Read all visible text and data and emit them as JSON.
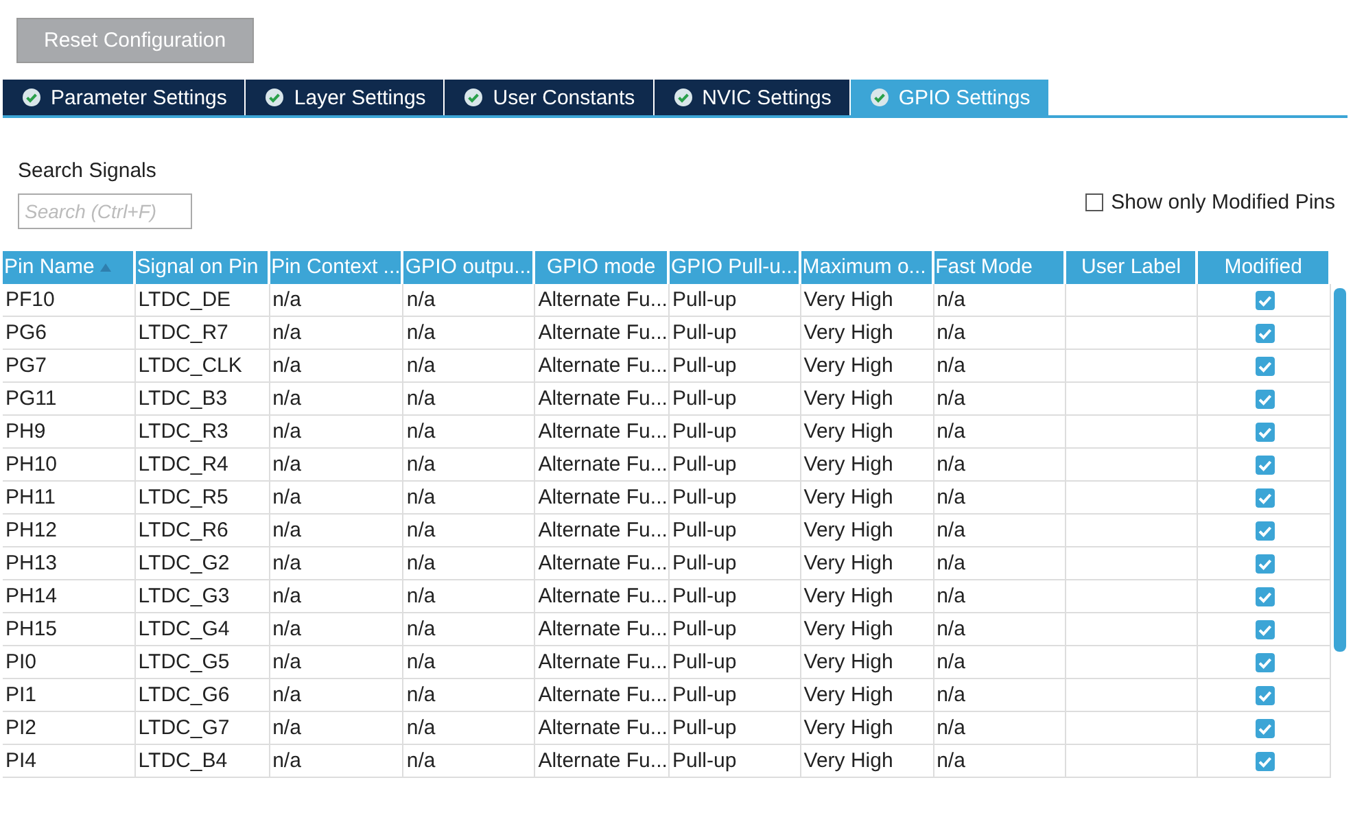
{
  "reset_button": "Reset Configuration",
  "tabs": [
    {
      "label": "Parameter Settings",
      "selected": false
    },
    {
      "label": "Layer Settings",
      "selected": false
    },
    {
      "label": "User Constants",
      "selected": false
    },
    {
      "label": "NVIC Settings",
      "selected": false
    },
    {
      "label": "GPIO Settings",
      "selected": true
    }
  ],
  "search": {
    "label": "Search Signals",
    "placeholder": "Search (Ctrl+F)"
  },
  "show_only_modified": {
    "label": "Show only Modified Pins",
    "checked": false
  },
  "table": {
    "columns": [
      "Pin Name",
      "Signal on Pin",
      "Pin Context ...",
      "GPIO outpu...",
      "GPIO mode",
      "GPIO Pull-u...",
      "Maximum o...",
      "Fast Mode",
      "User Label",
      "Modified"
    ],
    "rows": [
      {
        "cells": [
          "PF10",
          "LTDC_DE",
          "n/a",
          "n/a",
          "Alternate Fu...",
          "Pull-up",
          "Very High",
          "n/a"
        ],
        "modified": true
      },
      {
        "cells": [
          "PG6",
          "LTDC_R7",
          "n/a",
          "n/a",
          "Alternate Fu...",
          "Pull-up",
          "Very High",
          "n/a"
        ],
        "modified": true
      },
      {
        "cells": [
          "PG7",
          "LTDC_CLK",
          "n/a",
          "n/a",
          "Alternate Fu...",
          "Pull-up",
          "Very High",
          "n/a"
        ],
        "modified": true
      },
      {
        "cells": [
          "PG11",
          "LTDC_B3",
          "n/a",
          "n/a",
          "Alternate Fu...",
          "Pull-up",
          "Very High",
          "n/a"
        ],
        "modified": true
      },
      {
        "cells": [
          "PH9",
          "LTDC_R3",
          "n/a",
          "n/a",
          "Alternate Fu...",
          "Pull-up",
          "Very High",
          "n/a"
        ],
        "modified": true
      },
      {
        "cells": [
          "PH10",
          "LTDC_R4",
          "n/a",
          "n/a",
          "Alternate Fu...",
          "Pull-up",
          "Very High",
          "n/a"
        ],
        "modified": true
      },
      {
        "cells": [
          "PH11",
          "LTDC_R5",
          "n/a",
          "n/a",
          "Alternate Fu...",
          "Pull-up",
          "Very High",
          "n/a"
        ],
        "modified": true
      },
      {
        "cells": [
          "PH12",
          "LTDC_R6",
          "n/a",
          "n/a",
          "Alternate Fu...",
          "Pull-up",
          "Very High",
          "n/a"
        ],
        "modified": true
      },
      {
        "cells": [
          "PH13",
          "LTDC_G2",
          "n/a",
          "n/a",
          "Alternate Fu...",
          "Pull-up",
          "Very High",
          "n/a"
        ],
        "modified": true
      },
      {
        "cells": [
          "PH14",
          "LTDC_G3",
          "n/a",
          "n/a",
          "Alternate Fu...",
          "Pull-up",
          "Very High",
          "n/a"
        ],
        "modified": true
      },
      {
        "cells": [
          "PH15",
          "LTDC_G4",
          "n/a",
          "n/a",
          "Alternate Fu...",
          "Pull-up",
          "Very High",
          "n/a"
        ],
        "modified": true
      },
      {
        "cells": [
          "PI0",
          "LTDC_G5",
          "n/a",
          "n/a",
          "Alternate Fu...",
          "Pull-up",
          "Very High",
          "n/a"
        ],
        "modified": true
      },
      {
        "cells": [
          "PI1",
          "LTDC_G6",
          "n/a",
          "n/a",
          "Alternate Fu...",
          "Pull-up",
          "Very High",
          "n/a"
        ],
        "modified": true
      },
      {
        "cells": [
          "PI2",
          "LTDC_G7",
          "n/a",
          "n/a",
          "Alternate Fu...",
          "Pull-up",
          "Very High",
          "n/a"
        ],
        "modified": true
      },
      {
        "cells": [
          "PI4",
          "LTDC_B4",
          "n/a",
          "n/a",
          "Alternate Fu...",
          "Pull-up",
          "Very High",
          "n/a"
        ],
        "modified": true
      }
    ]
  }
}
